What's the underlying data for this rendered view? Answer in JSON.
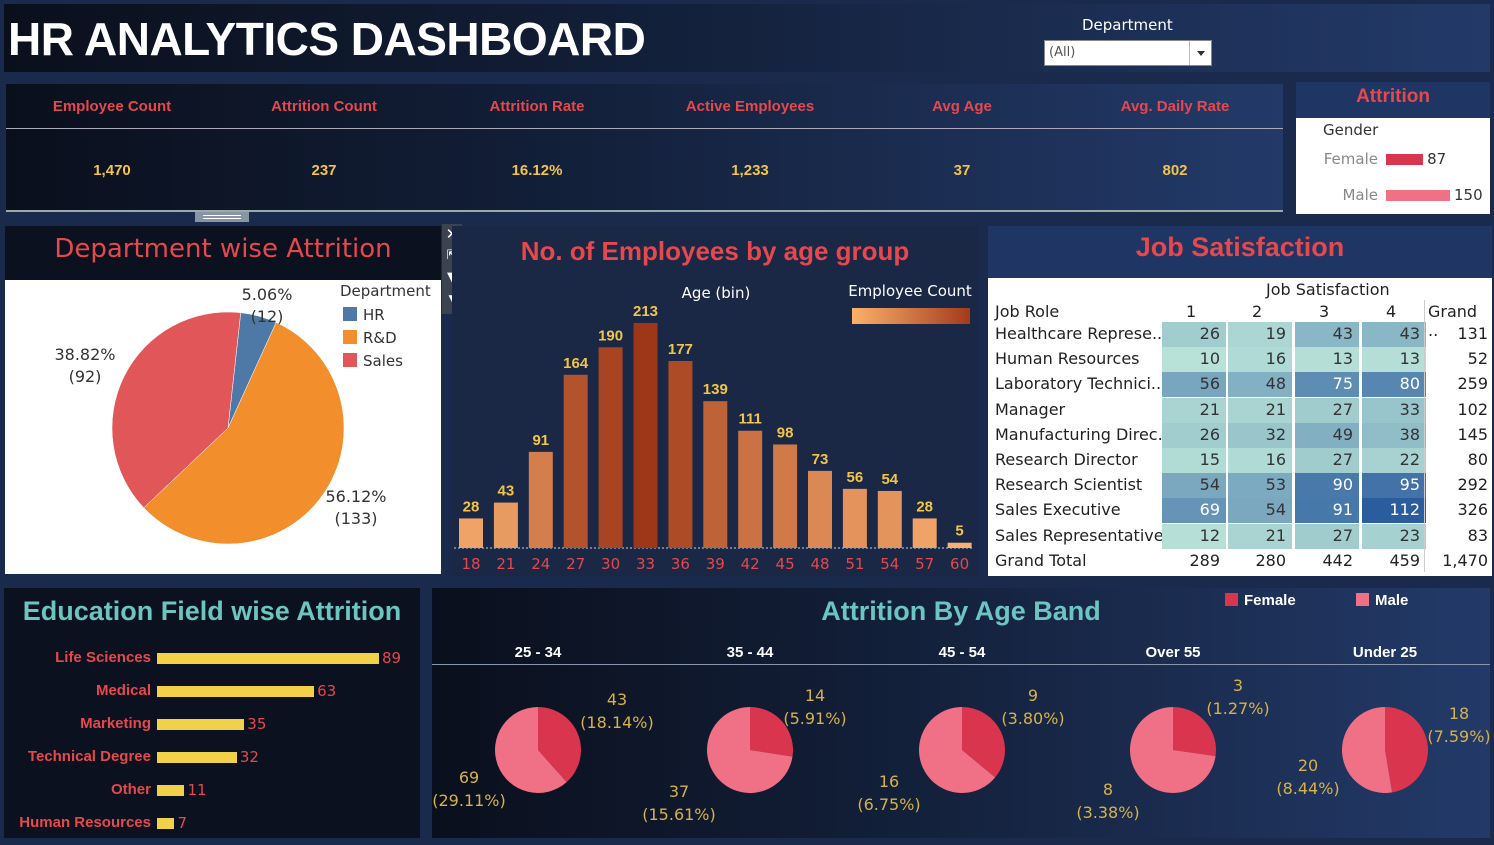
{
  "header": {
    "title": "HR ANALYTICS DASHBOARD",
    "filter_label": "Department",
    "filter_value": "(All)"
  },
  "kpis": [
    {
      "label": "Employee Count",
      "value": "1,470"
    },
    {
      "label": "Attrition Count",
      "value": "237"
    },
    {
      "label": "Attrition Rate",
      "value": "16.12%"
    },
    {
      "label": "Active Employees",
      "value": "1,233"
    },
    {
      "label": "Avg Age",
      "value": "37"
    },
    {
      "label": "Avg. Daily Rate",
      "value": "802"
    }
  ],
  "colors": {
    "accent_red": "#e5484d",
    "gold": "#f2c54a",
    "teal": "#6cc5c0",
    "female": "#d9354e",
    "male": "#f07086",
    "hr": "#4e79a7",
    "rnd": "#f28e2b",
    "sales": "#e15759",
    "edu_bar": "#f2d048"
  },
  "chart_data": [
    {
      "id": "attrition_gender",
      "type": "bar",
      "title": "Attrition",
      "xlabel": "Gender",
      "categories": [
        "Female",
        "Male"
      ],
      "values": [
        87,
        150
      ]
    },
    {
      "id": "dept_attrition",
      "type": "pie",
      "title": "Department wise Attrition",
      "legend_title": "Department",
      "categories": [
        "HR",
        "R&D",
        "Sales"
      ],
      "values": [
        12,
        133,
        92
      ],
      "percent_labels": [
        "5.06%",
        "56.12%",
        "38.82%"
      ],
      "count_labels": [
        "(12)",
        "(133)",
        "(92)"
      ]
    },
    {
      "id": "age_group",
      "type": "bar",
      "title": "No. of Employees by age group",
      "xlabel": "Age (bin)",
      "legend_title": "Employee Count",
      "categories": [
        "18",
        "21",
        "24",
        "27",
        "30",
        "33",
        "36",
        "39",
        "42",
        "45",
        "48",
        "51",
        "54",
        "57",
        "60"
      ],
      "values": [
        28,
        43,
        91,
        164,
        190,
        213,
        177,
        139,
        111,
        98,
        73,
        56,
        54,
        28,
        5
      ]
    },
    {
      "id": "job_satisfaction",
      "type": "heatmap",
      "title": "Job Satisfaction",
      "column_header": "Job Satisfaction",
      "row_header": "Job Role",
      "columns": [
        "1",
        "2",
        "3",
        "4"
      ],
      "total_label": "Grand ..",
      "rows": [
        "Healthcare Represe..",
        "Human Resources",
        "Laboratory Technici..",
        "Manager",
        "Manufacturing Direc..",
        "Research Director",
        "Research Scientist",
        "Sales Executive",
        "Sales Representative"
      ],
      "values": [
        [
          26,
          19,
          43,
          43
        ],
        [
          10,
          16,
          13,
          13
        ],
        [
          56,
          48,
          75,
          80
        ],
        [
          21,
          21,
          27,
          33
        ],
        [
          26,
          32,
          49,
          38
        ],
        [
          15,
          16,
          27,
          22
        ],
        [
          54,
          53,
          90,
          95
        ],
        [
          69,
          54,
          91,
          112
        ],
        [
          12,
          21,
          27,
          23
        ]
      ],
      "row_totals": [
        "131",
        "52",
        "259",
        "102",
        "145",
        "80",
        "292",
        "326",
        "83"
      ],
      "grand_total_label": "Grand Total",
      "column_totals": [
        "289",
        "280",
        "442",
        "459"
      ],
      "grand_total": "1,470"
    },
    {
      "id": "edu_attrition",
      "type": "bar",
      "title": "Education Field wise Attrition",
      "categories": [
        "Life Sciences",
        "Medical",
        "Marketing",
        "Technical Degree",
        "Other",
        "Human Resources"
      ],
      "values": [
        89,
        63,
        35,
        32,
        11,
        7
      ]
    },
    {
      "id": "age_band",
      "type": "pie",
      "title": "Attrition By Age Band",
      "legend": [
        "Female",
        "Male"
      ],
      "groups": [
        {
          "name": "25 - 34",
          "female": 43,
          "male": 69,
          "female_labels": [
            "43",
            "(18.14%)"
          ],
          "male_labels": [
            "69",
            "(29.11%)"
          ]
        },
        {
          "name": "35 - 44",
          "female": 14,
          "male": 37,
          "female_labels": [
            "14",
            "(5.91%)"
          ],
          "male_labels": [
            "37",
            "(15.61%)"
          ]
        },
        {
          "name": "45 - 54",
          "female": 9,
          "male": 16,
          "female_labels": [
            "9",
            "(3.80%)"
          ],
          "male_labels": [
            "16",
            "(6.75%)"
          ]
        },
        {
          "name": "Over 55",
          "female": 3,
          "male": 8,
          "female_labels": [
            "3",
            "(1.27%)"
          ],
          "male_labels": [
            "8",
            "(3.38%)"
          ]
        },
        {
          "name": "Under 25",
          "female": 18,
          "male": 20,
          "female_labels": [
            "18",
            "(7.59%)"
          ],
          "male_labels": [
            "20",
            "(8.44%)"
          ]
        }
      ]
    }
  ]
}
